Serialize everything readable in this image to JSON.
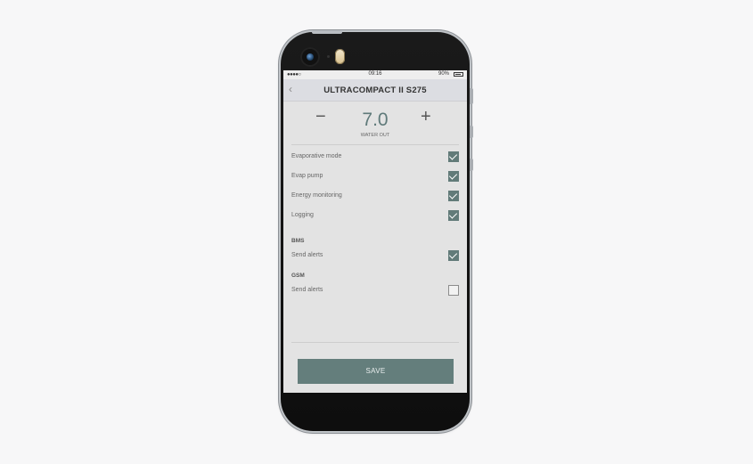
{
  "status_bar": {
    "signal": "●●●●○",
    "time": "09:16",
    "battery": "90%"
  },
  "header": {
    "back": "‹",
    "title": "ULTRACOMPACT II S275"
  },
  "setpoint": {
    "minus": "−",
    "plus": "+",
    "value": "7.0",
    "label": "WATER OUT"
  },
  "settings": [
    {
      "label": "Evaporative mode",
      "checked": true
    },
    {
      "label": "Evap pump",
      "checked": true
    },
    {
      "label": "Energy monitoring",
      "checked": true
    },
    {
      "label": "Logging",
      "checked": true
    }
  ],
  "bms": {
    "title": "BMS",
    "label": "Send alerts",
    "checked": true
  },
  "gsm": {
    "title": "GSM",
    "label": "Send alerts",
    "checked": false
  },
  "save_label": "SAVE",
  "colors": {
    "accent": "#647e7c",
    "background": "#e3e3e3"
  }
}
